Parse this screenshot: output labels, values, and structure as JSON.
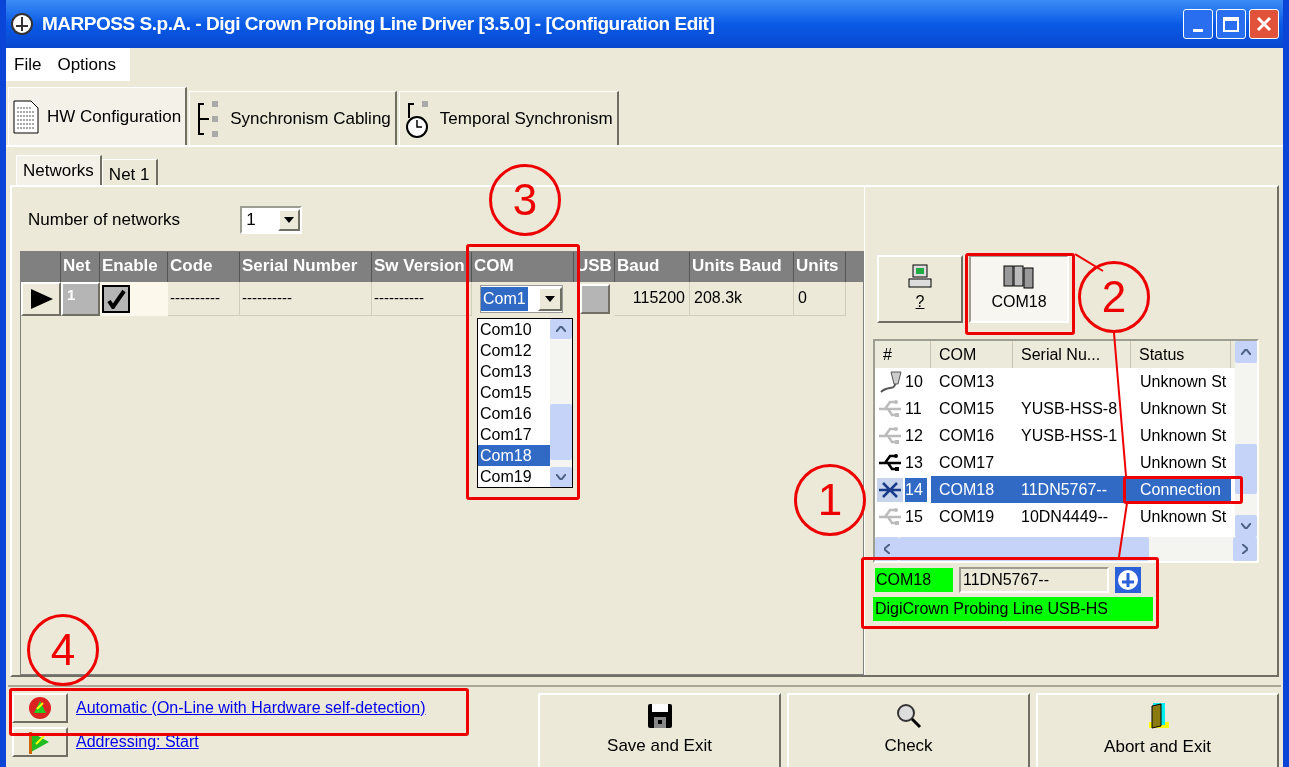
{
  "window": {
    "title": "MARPOSS S.p.A. - Digi Crown Probing Line Driver [3.5.0] - [Configuration Edit]"
  },
  "menu": [
    "File",
    "Options"
  ],
  "main_tabs": [
    {
      "label": "HW Configuration",
      "kind": "document",
      "selected": true
    },
    {
      "label": "Synchronism Cabling",
      "kind": "cabling",
      "selected": false
    },
    {
      "label": "Temporal Synchronism",
      "kind": "clock",
      "selected": false
    }
  ],
  "sub_tabs": [
    {
      "label": "Networks",
      "selected": true
    },
    {
      "label": "Net 1",
      "selected": false
    }
  ],
  "networks": {
    "label": "Number of networks",
    "value": "1"
  },
  "table": {
    "columns": [
      "Net",
      "Enable",
      "Code",
      "Serial Number",
      "Sw Version",
      "COM",
      "USB",
      "Baud",
      "Units Baud",
      "Units"
    ],
    "rows": [
      {
        "net": "1",
        "enabled": true,
        "code": "----------",
        "serial": "----------",
        "sw_version": "----------",
        "com": "Com1",
        "baud": "115200",
        "units_baud": "208.3k",
        "units": "0"
      }
    ]
  },
  "com_dropdown": [
    {
      "label": "Com10",
      "selected": false
    },
    {
      "label": "Com12",
      "selected": false
    },
    {
      "label": "Com13",
      "selected": false
    },
    {
      "label": "Com15",
      "selected": false
    },
    {
      "label": "Com16",
      "selected": false
    },
    {
      "label": "Com17",
      "selected": false
    },
    {
      "label": "Com18",
      "selected": true
    },
    {
      "label": "Com19",
      "selected": false
    }
  ],
  "device_buttons": [
    {
      "label": "?",
      "kind": "computer",
      "selected": false
    },
    {
      "label": "COM18",
      "kind": "ports",
      "selected": true
    }
  ],
  "ports": {
    "columns": [
      "#",
      "COM",
      "Serial Nu...",
      "Status"
    ],
    "rows": [
      {
        "kind": "serial",
        "number": "10",
        "com": "COM13",
        "status": "Unknown St",
        "selected": false
      },
      {
        "kind": "idle",
        "number": "11",
        "com": "COM15",
        "serial": "YUSB-HSS-8",
        "status": "Unknown St",
        "selected": false
      },
      {
        "kind": "idle",
        "number": "12",
        "com": "COM16",
        "serial": "YUSB-HSS-1",
        "status": "Unknown St",
        "selected": false
      },
      {
        "kind": "usb",
        "number": "13",
        "com": "COM17",
        "status": "Unknown St",
        "selected": false
      },
      {
        "kind": "linked",
        "number": "14",
        "com": "COM18",
        "serial": "11DN5767--",
        "status": "Connection",
        "selected": true
      },
      {
        "kind": "idle",
        "number": "15",
        "com": "COM19",
        "serial": "10DN4449--",
        "status": "Unknown St",
        "selected": false
      }
    ]
  },
  "device_info": {
    "com": "COM18",
    "serial": "11DN5767--",
    "description": "DigiCrown Probing Line USB-HS"
  },
  "actions": [
    {
      "label": "Automatic (On-Line with Hardware self-detection)",
      "kind": "auto"
    },
    {
      "label": "Addressing: Start",
      "kind": "address"
    }
  ],
  "buttons": [
    {
      "label": "Save and Exit",
      "kind": "save"
    },
    {
      "label": "Check",
      "kind": "check"
    },
    {
      "label": "Abort and Exit",
      "kind": "abort"
    }
  ],
  "callouts": [
    "1",
    "2",
    "3",
    "4"
  ]
}
